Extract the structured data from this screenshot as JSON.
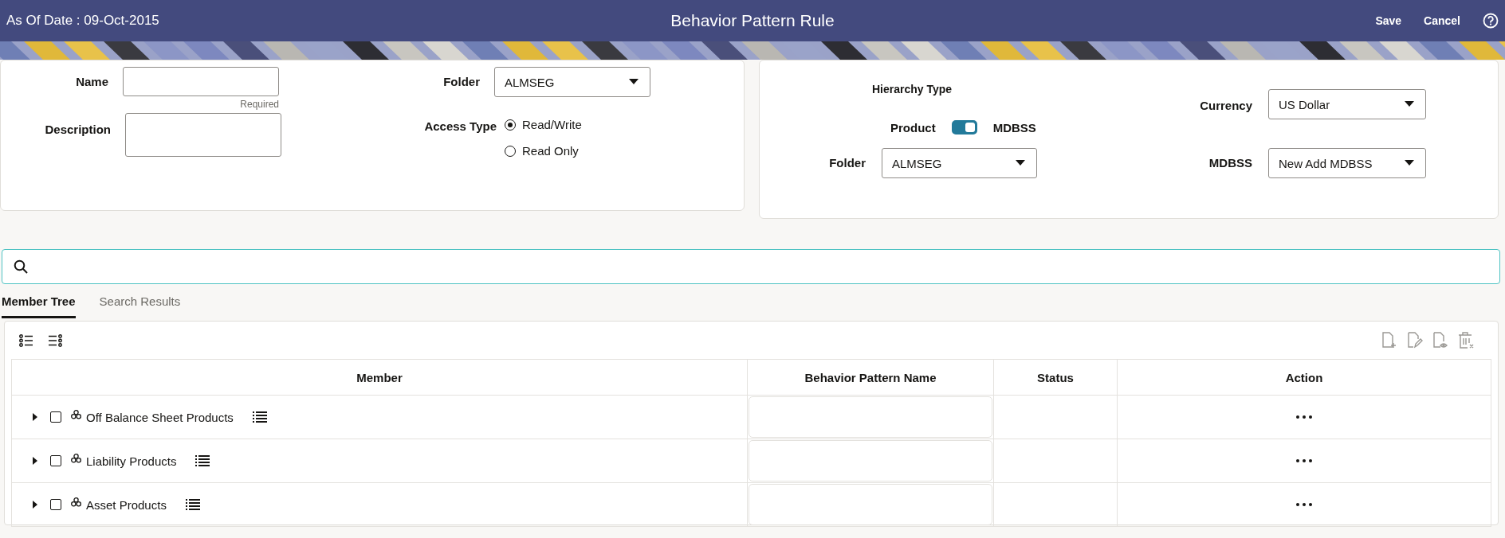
{
  "header": {
    "as_of": "As Of Date : 09-Oct-2015",
    "title": "Behavior Pattern Rule",
    "actions": [
      "Save",
      "Cancel"
    ]
  },
  "form_left": {
    "name": {
      "label": "Name",
      "hint": "Required"
    },
    "description": {
      "label": "Description"
    },
    "folder": {
      "label": "Folder",
      "value": "ALMSEG"
    },
    "access_type": {
      "label": "Access Type",
      "options": [
        {
          "label": "Read/Write",
          "selected": true
        },
        {
          "label": "Read Only",
          "selected": false
        }
      ]
    }
  },
  "form_right": {
    "hierarchy_type": {
      "label": "Hierarchy Type",
      "left_label": "Product",
      "right_label": "MDBSS",
      "on": true
    },
    "currency": {
      "label": "Currency",
      "value": "US Dollar"
    },
    "folder": {
      "label": "Folder",
      "value": "ALMSEG"
    },
    "mdbss": {
      "label": "MDBSS",
      "value": "New Add MDBSS"
    }
  },
  "tabs": [
    {
      "label": "Member Tree",
      "selected": true
    },
    {
      "label": "Search Results",
      "selected": false
    }
  ],
  "table": {
    "columns": [
      "Member",
      "Behavior Pattern Name",
      "Status",
      "Action"
    ],
    "rows": [
      {
        "member": "Off Balance Sheet Products",
        "expanded": false,
        "checked": false
      },
      {
        "member": "Liability Products",
        "expanded": false,
        "checked": false
      },
      {
        "member": "Asset Products",
        "expanded": false,
        "checked": false
      }
    ]
  }
}
